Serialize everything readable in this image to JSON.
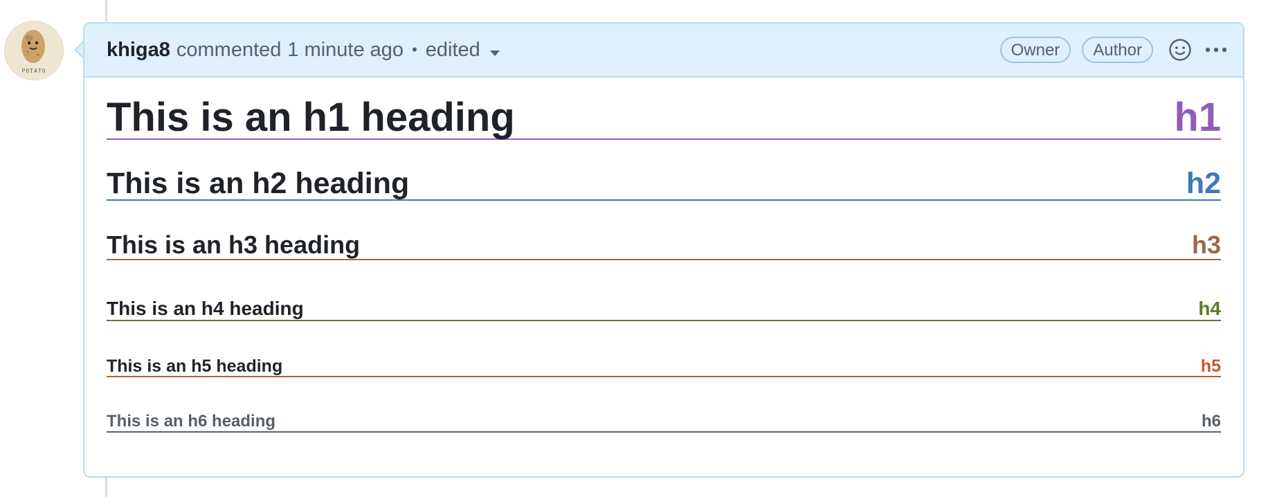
{
  "comment": {
    "author": "khiga8",
    "action": "commented",
    "time": "1 minute ago",
    "separator": "•",
    "edited": "edited",
    "badges": [
      "Owner",
      "Author"
    ]
  },
  "avatar": {
    "text": "POTATO"
  },
  "headings": [
    {
      "text": "This is an h1 heading",
      "tag": "h1",
      "color": "#8f5fb8"
    },
    {
      "text": "This is an h2 heading",
      "tag": "h2",
      "color": "#3d7ab8"
    },
    {
      "text": "This is an h3 heading",
      "tag": "h3",
      "color": "#9a6a48"
    },
    {
      "text": "This is an h4 heading",
      "tag": "h4",
      "color": "#5e7a2a"
    },
    {
      "text": "This is an h5 heading",
      "tag": "h5",
      "color": "#c8562c"
    },
    {
      "text": "This is an h6 heading",
      "tag": "h6",
      "color": "#57606a"
    }
  ],
  "colors": {
    "header_bg": "#ddf0fc",
    "border": "#b6dcf5",
    "text": "#1f2328",
    "muted": "#57606a"
  },
  "icons": [
    "caret-down-icon",
    "smiley-icon",
    "kebab-horizontal-icon"
  ]
}
